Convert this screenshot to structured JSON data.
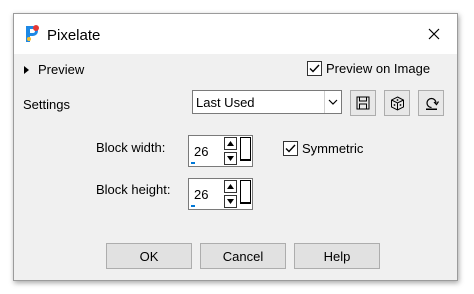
{
  "window": {
    "title": "Pixelate"
  },
  "preview": {
    "toggle_label": "Preview",
    "on_image_label": "Preview on Image",
    "on_image_checked": true
  },
  "settings": {
    "label": "Settings",
    "preset_value": "Last Used"
  },
  "block_width": {
    "label": "Block width:",
    "value": "26"
  },
  "block_height": {
    "label": "Block height:",
    "value": "26"
  },
  "symmetric": {
    "label": "Symmetric",
    "checked": true
  },
  "buttons": {
    "ok": "OK",
    "cancel": "Cancel",
    "help": "Help"
  },
  "colors": {
    "accent": "#0078d7",
    "dialog_bg": "#f0f0f0"
  }
}
